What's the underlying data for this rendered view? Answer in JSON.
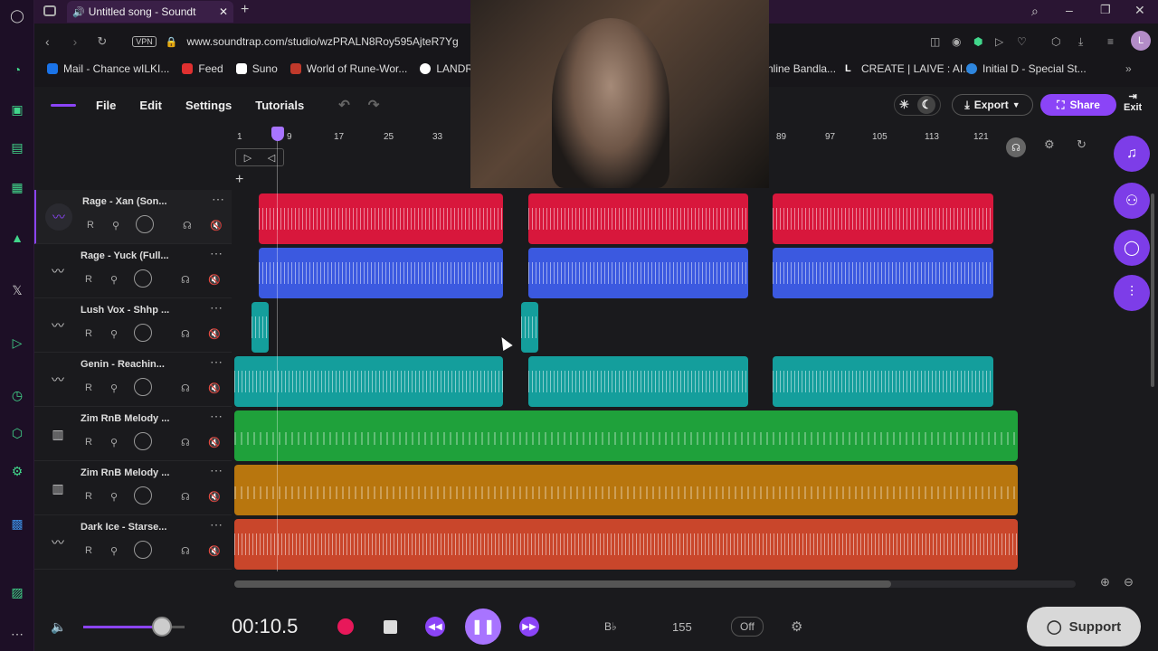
{
  "browser": {
    "tab_title": "Untitled song - Soundt",
    "url": "www.soundtrap.com/studio/wzPRALN8Roy595AjteR7Yg/",
    "vpn_label": "VPN",
    "bookmarks": [
      {
        "label": "Mail - Chance wILKI...",
        "color": "#1a73e8"
      },
      {
        "label": "Feed",
        "color": "#e03030"
      },
      {
        "label": "Suno",
        "color": "#ffffff"
      },
      {
        "label": "World of Rune-Wor...",
        "color": "#c0392b"
      },
      {
        "label": "LANDR",
        "color": "#ffffff"
      },
      {
        "label": "nline Bandla...",
        "color": "#888888"
      },
      {
        "label": "CREATE | LAIVE : AI...",
        "color": "#ffffff"
      },
      {
        "label": "Initial D - Special St...",
        "color": "#2e86de"
      }
    ]
  },
  "menu": {
    "file": "File",
    "edit": "Edit",
    "settings": "Settings",
    "tutorials": "Tutorials",
    "export": "Export",
    "share": "Share",
    "exit": "Exit"
  },
  "ruler": [
    "1",
    "9",
    "17",
    "25",
    "33",
    "89",
    "97",
    "105",
    "113",
    "121"
  ],
  "tracks": [
    {
      "name": "Rage - Xan (Son...",
      "color": "#d8173c",
      "type": "audio"
    },
    {
      "name": "Rage - Yuck (Full...",
      "color": "#3b59e0",
      "type": "audio"
    },
    {
      "name": "Lush Vox - Shhp ...",
      "color": "#149e9c",
      "type": "audio"
    },
    {
      "name": "Genin - Reachin...",
      "color": "#149e9c",
      "type": "audio"
    },
    {
      "name": "Zim RnB Melody ...",
      "color": "#1fa13b",
      "type": "midi"
    },
    {
      "name": "Zim RnB Melody ...",
      "color": "#b8760e",
      "type": "midi"
    },
    {
      "name": "Dark Ice - Starse...",
      "color": "#c9462b",
      "type": "audio"
    }
  ],
  "track_controls": {
    "r": "R",
    "vol": "Vol"
  },
  "transport": {
    "time": "00:10.5",
    "key": "B♭",
    "tempo": "155",
    "metronome": "Off",
    "support": "Support"
  },
  "colors": {
    "accent": "#8b44f7",
    "record": "#e8185a"
  }
}
